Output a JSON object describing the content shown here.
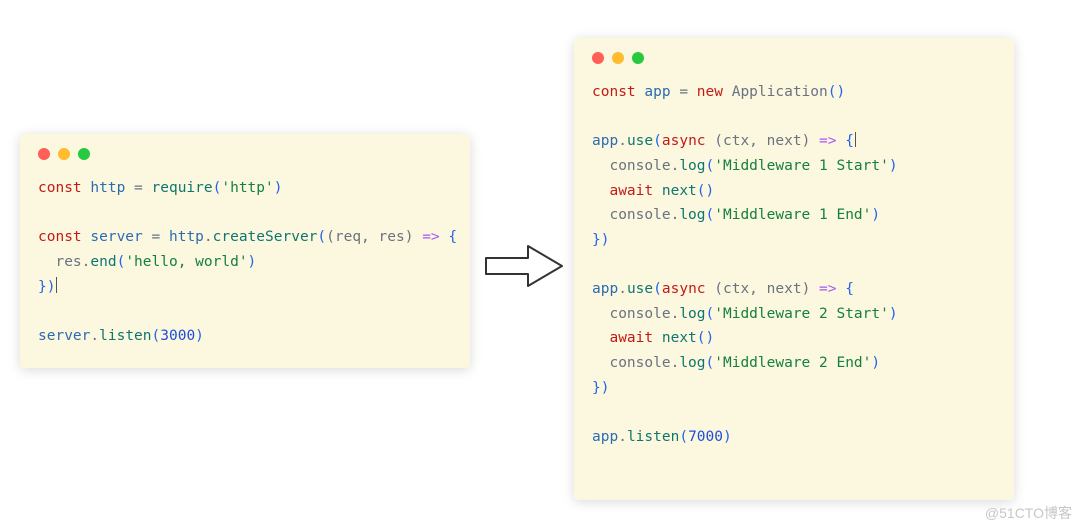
{
  "left": {
    "lines": [
      [
        {
          "t": "const ",
          "c": "kw"
        },
        {
          "t": "http",
          "c": "id"
        },
        {
          "t": " = ",
          "c": "pun"
        },
        {
          "t": "require",
          "c": "fn"
        },
        {
          "t": "(",
          "c": "par"
        },
        {
          "t": "'http'",
          "c": "str"
        },
        {
          "t": ")",
          "c": "par"
        }
      ],
      [],
      [
        {
          "t": "const ",
          "c": "kw"
        },
        {
          "t": "server",
          "c": "id"
        },
        {
          "t": " = ",
          "c": "pun"
        },
        {
          "t": "http",
          "c": "id"
        },
        {
          "t": ".",
          "c": "pun"
        },
        {
          "t": "createServer",
          "c": "fn"
        },
        {
          "t": "(",
          "c": "par"
        },
        {
          "t": "(req, res)",
          "c": "pun"
        },
        {
          "t": " ",
          "c": "pun"
        },
        {
          "t": "=>",
          "c": "op"
        },
        {
          "t": " ",
          "c": "pun"
        },
        {
          "t": "{",
          "c": "par"
        }
      ],
      [
        {
          "t": "  res",
          "c": "pun"
        },
        {
          "t": ".",
          "c": "pun"
        },
        {
          "t": "end",
          "c": "fn"
        },
        {
          "t": "(",
          "c": "par"
        },
        {
          "t": "'hello, world'",
          "c": "str"
        },
        {
          "t": ")",
          "c": "par"
        }
      ],
      [
        {
          "t": "}",
          "c": "par"
        },
        {
          "t": ")",
          "c": "par"
        },
        {
          "cursor": true
        }
      ],
      [],
      [
        {
          "t": "server",
          "c": "id"
        },
        {
          "t": ".",
          "c": "pun"
        },
        {
          "t": "listen",
          "c": "fn"
        },
        {
          "t": "(",
          "c": "par"
        },
        {
          "t": "3000",
          "c": "num"
        },
        {
          "t": ")",
          "c": "par"
        }
      ]
    ]
  },
  "right": {
    "lines": [
      [
        {
          "t": "const ",
          "c": "kw"
        },
        {
          "t": "app",
          "c": "id"
        },
        {
          "t": " = ",
          "c": "pun"
        },
        {
          "t": "new ",
          "c": "kw"
        },
        {
          "t": "Application",
          "c": "cls"
        },
        {
          "t": "()",
          "c": "par"
        }
      ],
      [],
      [
        {
          "t": "app",
          "c": "id"
        },
        {
          "t": ".",
          "c": "pun"
        },
        {
          "t": "use",
          "c": "fn"
        },
        {
          "t": "(",
          "c": "par"
        },
        {
          "t": "async ",
          "c": "kw"
        },
        {
          "t": "(ctx, next)",
          "c": "pun"
        },
        {
          "t": " ",
          "c": "pun"
        },
        {
          "t": "=>",
          "c": "op"
        },
        {
          "t": " ",
          "c": "pun"
        },
        {
          "t": "{",
          "c": "par"
        },
        {
          "cursor": true
        }
      ],
      [
        {
          "t": "  console",
          "c": "pun"
        },
        {
          "t": ".",
          "c": "pun"
        },
        {
          "t": "log",
          "c": "fn"
        },
        {
          "t": "(",
          "c": "par"
        },
        {
          "t": "'Middleware 1 Start'",
          "c": "str"
        },
        {
          "t": ")",
          "c": "par"
        }
      ],
      [
        {
          "t": "  ",
          "c": "pun"
        },
        {
          "t": "await ",
          "c": "kw"
        },
        {
          "t": "next",
          "c": "fn"
        },
        {
          "t": "()",
          "c": "par"
        }
      ],
      [
        {
          "t": "  console",
          "c": "pun"
        },
        {
          "t": ".",
          "c": "pun"
        },
        {
          "t": "log",
          "c": "fn"
        },
        {
          "t": "(",
          "c": "par"
        },
        {
          "t": "'Middleware 1 End'",
          "c": "str"
        },
        {
          "t": ")",
          "c": "par"
        }
      ],
      [
        {
          "t": "}",
          "c": "par"
        },
        {
          "t": ")",
          "c": "par"
        }
      ],
      [],
      [
        {
          "t": "app",
          "c": "id"
        },
        {
          "t": ".",
          "c": "pun"
        },
        {
          "t": "use",
          "c": "fn"
        },
        {
          "t": "(",
          "c": "par"
        },
        {
          "t": "async ",
          "c": "kw"
        },
        {
          "t": "(ctx, next)",
          "c": "pun"
        },
        {
          "t": " ",
          "c": "pun"
        },
        {
          "t": "=>",
          "c": "op"
        },
        {
          "t": " ",
          "c": "pun"
        },
        {
          "t": "{",
          "c": "par"
        }
      ],
      [
        {
          "t": "  console",
          "c": "pun"
        },
        {
          "t": ".",
          "c": "pun"
        },
        {
          "t": "log",
          "c": "fn"
        },
        {
          "t": "(",
          "c": "par"
        },
        {
          "t": "'Middleware 2 Start'",
          "c": "str"
        },
        {
          "t": ")",
          "c": "par"
        }
      ],
      [
        {
          "t": "  ",
          "c": "pun"
        },
        {
          "t": "await ",
          "c": "kw"
        },
        {
          "t": "next",
          "c": "fn"
        },
        {
          "t": "()",
          "c": "par"
        }
      ],
      [
        {
          "t": "  console",
          "c": "pun"
        },
        {
          "t": ".",
          "c": "pun"
        },
        {
          "t": "log",
          "c": "fn"
        },
        {
          "t": "(",
          "c": "par"
        },
        {
          "t": "'Middleware 2 End'",
          "c": "str"
        },
        {
          "t": ")",
          "c": "par"
        }
      ],
      [
        {
          "t": "}",
          "c": "par"
        },
        {
          "t": ")",
          "c": "par"
        }
      ],
      [],
      [
        {
          "t": "app",
          "c": "id"
        },
        {
          "t": ".",
          "c": "pun"
        },
        {
          "t": "listen",
          "c": "fn"
        },
        {
          "t": "(",
          "c": "par"
        },
        {
          "t": "7000",
          "c": "num"
        },
        {
          "t": ")",
          "c": "par"
        }
      ]
    ]
  },
  "watermark": "@51CTO博客"
}
